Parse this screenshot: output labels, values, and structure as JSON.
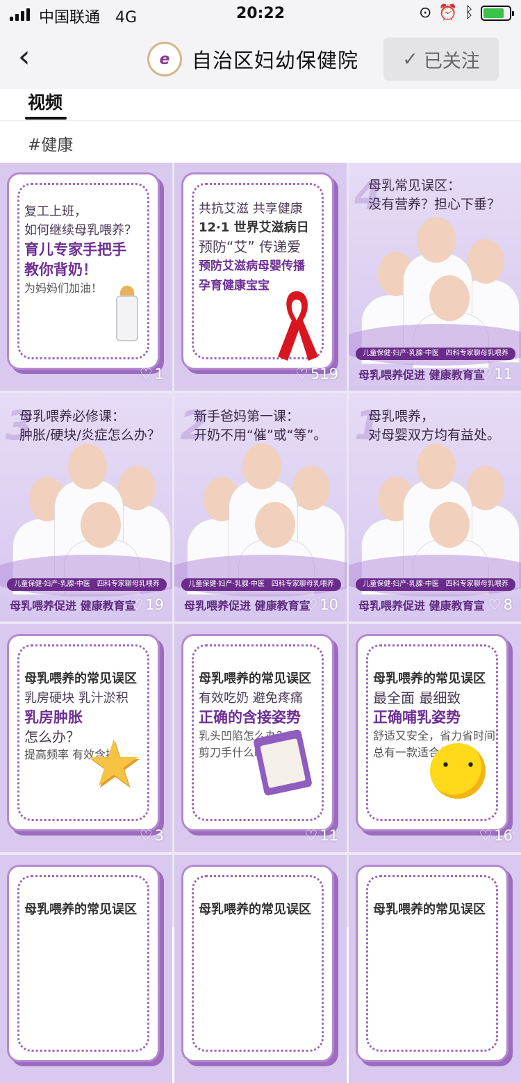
{
  "status": {
    "carrier": "中国联通",
    "network": "4G",
    "time": "20:22"
  },
  "nav": {
    "back_icon": "back-chevron-icon",
    "title": "自治区妇幼保健院",
    "follow_label": "已关注"
  },
  "tabs": {
    "active": "视频"
  },
  "tag": "#健康",
  "tiles": [
    {
      "kind": "card",
      "lines": [
        "复工上班，",
        "如何继续母乳喂养？"
      ],
      "strong": [
        "育儿专家手把手",
        "教你背奶！"
      ],
      "sub": "为妈妈们加油！",
      "likes": "1"
    },
    {
      "kind": "card",
      "lines": [
        "共抗艾滋 共享健康"
      ],
      "head": "12·1 世界艾滋病日",
      "lines2": [
        "预防“艾” 传递爱"
      ],
      "strong": [
        "预防艾滋病母婴传播",
        "孕育健康宝宝"
      ],
      "likes": "519"
    },
    {
      "kind": "photo",
      "num": "4",
      "title": [
        "母乳常见误区：",
        "没有营养？担心下垂？"
      ],
      "bar1": "儿童保健·妇产·乳腺·中医　四科专家聊母乳喂养",
      "bar2": "母乳喂养促进 健康教育宣",
      "likes": "11"
    },
    {
      "kind": "photo",
      "num": "3",
      "title": [
        "母乳喂养必修课：",
        "肿胀/硬块/炎症怎么办？"
      ],
      "bar1": "儿童保健·妇产·乳腺·中医　四科专家聊母乳喂养",
      "bar2": "母乳喂养促进 健康教育宣",
      "likes": "19"
    },
    {
      "kind": "photo",
      "num": "2",
      "title": [
        "新手爸妈第一课：",
        "开奶不用“催”或“等”。"
      ],
      "bar1": "儿童保健·妇产·乳腺·中医　四科专家聊母乳喂养",
      "bar2": "母乳喂养促进 健康教育宣",
      "likes": "10"
    },
    {
      "kind": "photo",
      "num": "1",
      "title": [
        "母乳喂养，",
        "对母婴双方均有益处。"
      ],
      "bar1": "儿童保健·妇产·乳腺·中医　四科专家聊母乳喂养",
      "bar2": "母乳喂养促进 健康教育宣",
      "likes": "8"
    },
    {
      "kind": "card",
      "head": "母乳喂养的常见误区",
      "lines": [
        "乳房硬块 乳汁淤积"
      ],
      "strong": [
        "乳房肿胀"
      ],
      "lines2": [
        "怎么办？"
      ],
      "sub": "提高频率 有效含接",
      "likes": "3"
    },
    {
      "kind": "card",
      "head": "母乳喂养的常见误区",
      "lines": [
        "有效吃奶 避免疼痛"
      ],
      "strong": [
        "正确的含接姿势"
      ],
      "sub": "乳头凹陷怎么办？\n剪刀手什么时候用？",
      "likes": "11"
    },
    {
      "kind": "card",
      "head": "母乳喂养的常见误区",
      "lines": [
        "最全面 最细致"
      ],
      "strong": [
        "正确哺乳姿势"
      ],
      "sub": "舒适又安全，省力省时间\n总有一款适合你。",
      "likes": "16"
    },
    {
      "kind": "card",
      "head": "母乳喂养的常见误区"
    },
    {
      "kind": "card",
      "head": "母乳喂养的常见误区"
    },
    {
      "kind": "card",
      "head": "母乳喂养的常见误区"
    }
  ]
}
